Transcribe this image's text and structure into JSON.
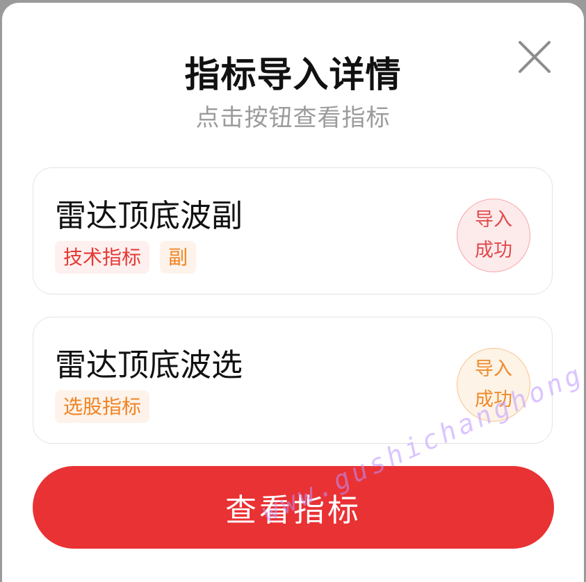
{
  "dialog": {
    "title": "指标导入详情",
    "subtitle": "点击按钮查看指标",
    "close_icon": "close-icon"
  },
  "cards": [
    {
      "title": "雷达顶底波副",
      "tags": [
        {
          "label": "技术指标",
          "color": "#e53935"
        },
        {
          "label": "副",
          "color": "#f08322"
        }
      ],
      "status": {
        "line1": "导入",
        "line2": "成功",
        "color": "#e04a4a"
      }
    },
    {
      "title": "雷达顶底波选",
      "tags": [
        {
          "label": "选股指标",
          "color": "#f08322"
        }
      ],
      "status": {
        "line1": "导入",
        "line2": "成功",
        "color": "#ef8a2b"
      }
    }
  ],
  "cta": {
    "label": "查看指标",
    "color": "#e93234"
  },
  "watermark": "www.gushichanghong.com"
}
